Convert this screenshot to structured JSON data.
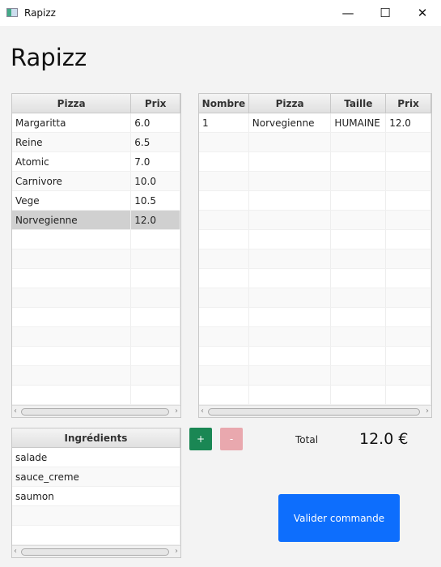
{
  "window": {
    "title": "Rapizz"
  },
  "heading": "Rapizz",
  "menu_table": {
    "headers": [
      "Pizza",
      "Prix"
    ],
    "rows": [
      [
        "Margaritta",
        "6.0"
      ],
      [
        "Reine",
        "6.5"
      ],
      [
        "Atomic",
        "7.0"
      ],
      [
        "Carnivore",
        "10.0"
      ],
      [
        "Vege",
        "10.5"
      ],
      [
        "Norvegienne",
        "12.0"
      ]
    ],
    "selected_index": 5
  },
  "order_table": {
    "headers": [
      "Nombre",
      "Pizza",
      "Taille",
      "Prix"
    ],
    "rows": [
      [
        "1",
        "Norvegienne",
        "HUMAINE",
        "12.0"
      ]
    ]
  },
  "ingredients_table": {
    "headers": [
      "Ingrédients"
    ],
    "rows": [
      [
        "salade"
      ],
      [
        "sauce_creme"
      ],
      [
        "saumon"
      ]
    ]
  },
  "buttons": {
    "add": "+",
    "remove": "-",
    "validate": "Valider commande"
  },
  "total": {
    "label": "Total",
    "value": "12.0 €"
  },
  "colors": {
    "add": "#1a8754",
    "remove": "#e9a8ae",
    "validate": "#0d6efd"
  }
}
